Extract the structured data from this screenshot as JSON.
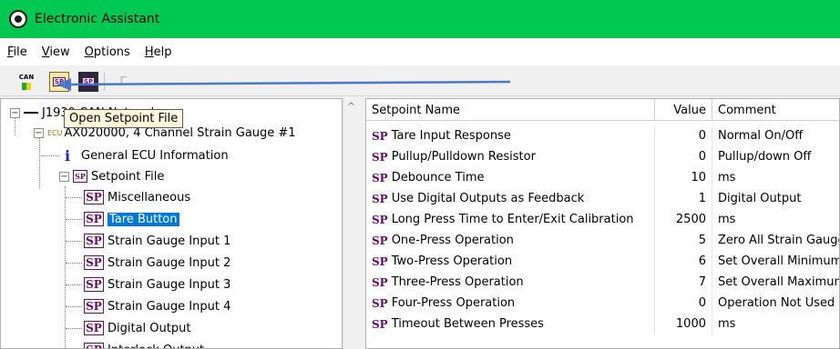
{
  "window": {
    "title": "Electronic Assistant"
  },
  "menu": {
    "file_label": "File",
    "file_key": "F",
    "file_rest": "ile",
    "view_label": "View",
    "view_key": "V",
    "view_rest": "iew",
    "options_label": "Options",
    "options_key": "O",
    "options_rest": "ptions",
    "help_label": "Help",
    "help_key": "H",
    "help_rest": "elp"
  },
  "toolbar": {
    "can_icon_text": "CAN",
    "open_icon_text": "SP",
    "save_icon_text": "SP",
    "disabled_icon_text": "Γ",
    "tooltip": "Open Setpoint File"
  },
  "tree": {
    "network_label": "J1939 CAN Network",
    "ecu_tag": "ECU",
    "ecu_label": "AX020000, 4 Channel Strain Gauge #1",
    "general_info_label": "General ECU Information",
    "setpoint_file_label": "Setpoint File",
    "sp_icon_text": "SP",
    "items": [
      {
        "label": "Miscellaneous"
      },
      {
        "label": "Tare Button",
        "selected": true
      },
      {
        "label": "Strain Gauge Input 1"
      },
      {
        "label": "Strain Gauge Input 2"
      },
      {
        "label": "Strain Gauge Input 3"
      },
      {
        "label": "Strain Gauge Input 4"
      },
      {
        "label": "Digital Output"
      },
      {
        "label": "Interlock Output"
      }
    ]
  },
  "grid": {
    "columns": {
      "name": "Setpoint Name",
      "value": "Value",
      "comment": "Comment"
    },
    "sp_tag": "SP",
    "rows": [
      {
        "name": "Tare Input Response",
        "value": "0",
        "comment": "Normal On/Off"
      },
      {
        "name": "Pullup/Pulldown Resistor",
        "value": "0",
        "comment": "Pullup/down Off"
      },
      {
        "name": "Debounce Time",
        "value": "10",
        "comment": "ms"
      },
      {
        "name": "Use Digital Outputs as Feedback",
        "value": "1",
        "comment": "Digital Output"
      },
      {
        "name": "Long Press Time to Enter/Exit Calibration",
        "value": "2500",
        "comment": "ms"
      },
      {
        "name": "One-Press Operation",
        "value": "5",
        "comment": "Zero All Strain Gauges"
      },
      {
        "name": "Two-Press Operation",
        "value": "6",
        "comment": "Set Overall Minimum"
      },
      {
        "name": "Three-Press Operation",
        "value": "7",
        "comment": "Set Overall Maximum"
      },
      {
        "name": "Four-Press Operation",
        "value": "0",
        "comment": "Operation Not Used"
      },
      {
        "name": "Timeout Between Presses",
        "value": "1000",
        "comment": "ms"
      }
    ]
  },
  "colors": {
    "titlebar": "#00c850",
    "selection": "#0078d7",
    "sp_purple": "#6a0a6a",
    "annotation_arrow": "#4a78c8"
  }
}
